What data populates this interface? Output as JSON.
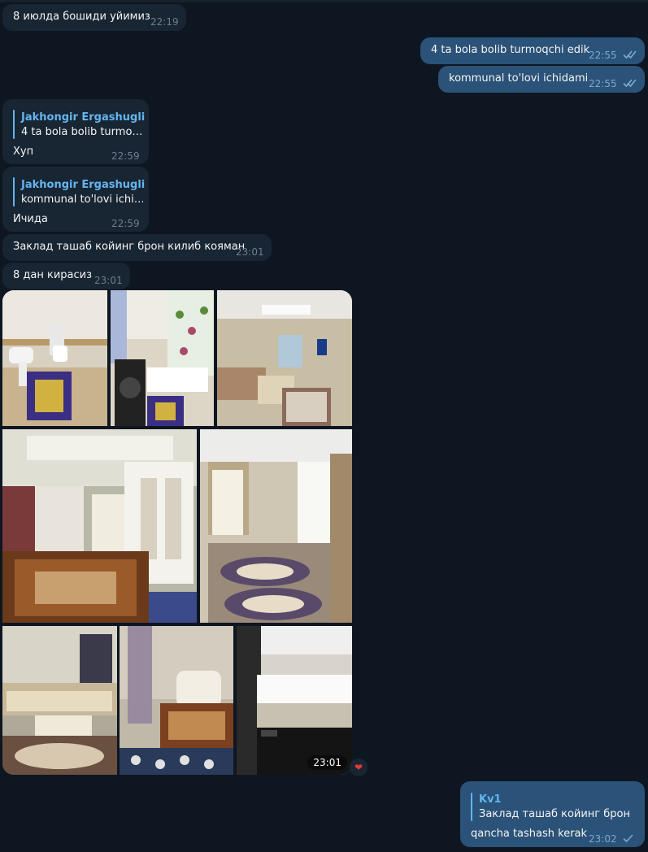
{
  "theme": {
    "background": "#0e1621",
    "incoming": "#182533",
    "outgoing": "#2b5278",
    "accent": "#64b5ef",
    "reaction": "#e53935"
  },
  "messages": [
    {
      "id": "m1",
      "direction": "incoming",
      "text": "8 июлда бошиди уйимиз",
      "time": "22:19"
    },
    {
      "id": "m2",
      "direction": "outgoing",
      "text": "4 ta bola bolib turmoqchi edik",
      "time": "22:55",
      "status": "double-check-icon"
    },
    {
      "id": "m3",
      "direction": "outgoing",
      "text": "kommunal to'lovi ichidami",
      "time": "22:55",
      "status": "double-check-icon"
    },
    {
      "id": "m4",
      "direction": "incoming",
      "reply": {
        "author": "Jakhongir Ergashugli",
        "text": "4 ta bola bolib turmo…"
      },
      "text": "Хуп",
      "time": "22:59"
    },
    {
      "id": "m5",
      "direction": "incoming",
      "reply": {
        "author": "Jakhongir Ergashugli",
        "text": "kommunal to'lovi ichi…"
      },
      "text": "Ичида",
      "time": "22:59"
    },
    {
      "id": "m6",
      "direction": "incoming",
      "text": "Заклад ташаб койинг брон килиб кояман",
      "time": "23:01"
    },
    {
      "id": "m7",
      "direction": "incoming",
      "text": "8 дан кирасиз",
      "time": "23:01"
    },
    {
      "id": "m8",
      "direction": "incoming",
      "album": {
        "time": "23:01",
        "reaction": "heart-icon",
        "photos": [
          "bathroom-toilet-photo",
          "bathroom-washer-photo",
          "living-room-photo",
          "bedroom-tiger-blanket-photo",
          "hallway-carpet-photo",
          "sitting-room-sofa-photo",
          "bedroom-tiger-photo",
          "kitchen-photo"
        ]
      }
    },
    {
      "id": "m9",
      "direction": "outgoing",
      "reply": {
        "author": "Kv1",
        "text": "Заклад ташаб койинг брон …"
      },
      "text": "qancha tashash kerak",
      "time": "23:02",
      "status": "single-check-icon"
    }
  ]
}
